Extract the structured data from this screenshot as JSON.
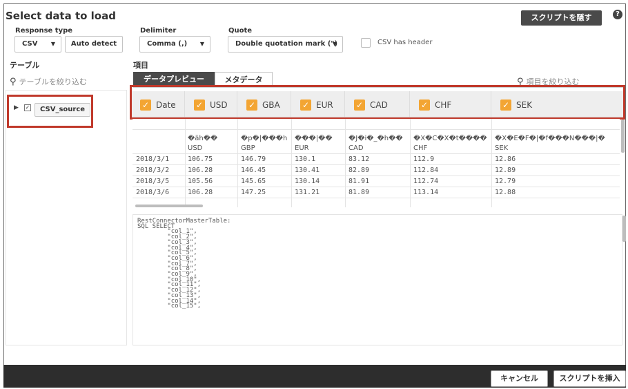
{
  "dialog": {
    "title": "Select data to load",
    "help_icon": "?",
    "top_button": "スクリプトを隠す"
  },
  "options": {
    "response_type_label": "Response type",
    "response_type_value": "CSV",
    "auto_detect": "Auto detect",
    "delimiter_label": "Delimiter",
    "delimiter_value": "Comma (,)",
    "quote_label": "Quote",
    "quote_value": "Double quotation mark (\")",
    "csv_header_label": "CSV has header"
  },
  "left": {
    "section_label": "テーブル",
    "search_placeholder": "テーブルを絞り込む",
    "table_name": "CSV_source"
  },
  "right": {
    "section_label": "項目",
    "tabs": [
      "データプレビュー",
      "メタデータ"
    ],
    "search_placeholder": "項目を絞り込む"
  },
  "columns": [
    "Date",
    "USD",
    "GBA",
    "EUR",
    "CAD",
    "CHF",
    "SEK"
  ],
  "grid": {
    "garbled_row": [
      "",
      "�äh��",
      "�p�|���h",
      "���|��",
      "�J�i�_�h��",
      "�X�C�X�t����",
      "�X�E�F�|�f���N���|�"
    ],
    "units_row": [
      "",
      "USD",
      "GBP",
      "EUR",
      "CAD",
      "CHF",
      "SEK"
    ],
    "rows": [
      [
        "2018/3/1",
        "106.75",
        "146.79",
        "130.1",
        "83.12",
        "112.9",
        "12.86"
      ],
      [
        "2018/3/2",
        "106.28",
        "146.45",
        "130.41",
        "82.89",
        "112.84",
        "12.89"
      ],
      [
        "2018/3/5",
        "105.56",
        "145.65",
        "130.14",
        "81.91",
        "112.74",
        "12.79"
      ],
      [
        "2018/3/6",
        "106.28",
        "147.25",
        "131.21",
        "81.89",
        "113.14",
        "12.88"
      ]
    ]
  },
  "script_text": "RestConnectorMasterTable:\nSQL SELECT\n        \"col_1\",\n        \"col_2\",\n        \"col_3\",\n        \"col_4\",\n        \"col_5\",\n        \"col_6\",\n        \"col_7\",\n        \"col_8\",\n        \"col_9\",\n        \"col_10\",\n        \"col_11\",\n        \"col_12\",\n        \"col_13\",\n        \"col_14\",\n        \"col_15\",",
  "footer": {
    "cancel": "キャンセル",
    "insert_script": "スクリプトを挿入"
  },
  "colors": {
    "accent_checkbox": "#f3a533",
    "highlight_box": "#c0392b",
    "dark": "#4a4a4a"
  }
}
